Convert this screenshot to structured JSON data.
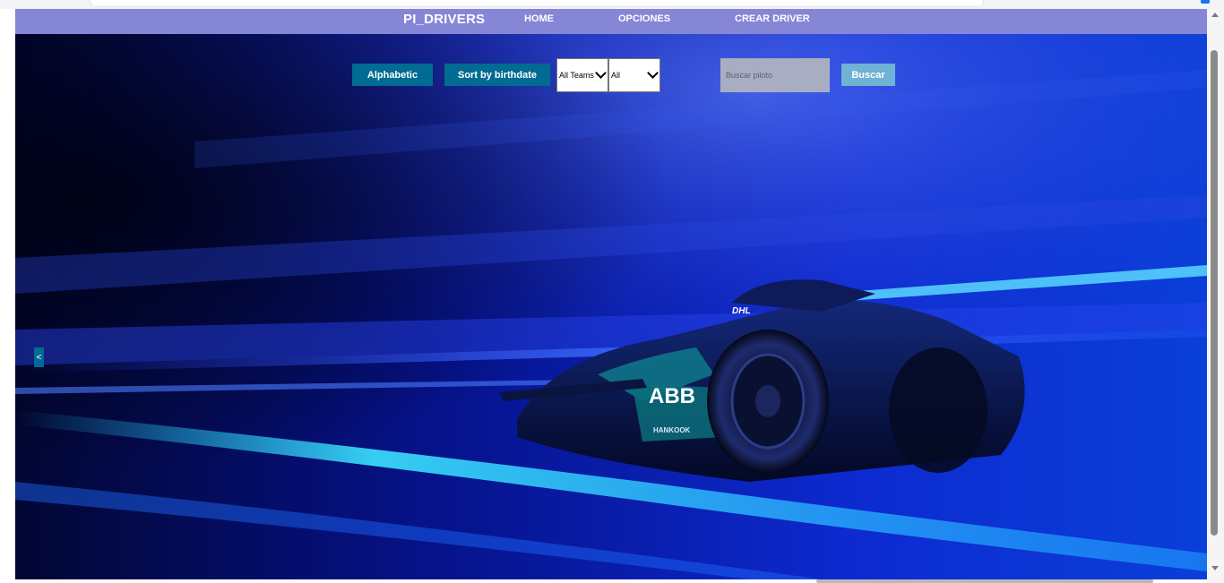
{
  "navbar": {
    "brand": "PI_DRIVERS",
    "links": [
      "HOME",
      "OPCIONES",
      "CREAR DRIVER"
    ],
    "background": "#8586d6"
  },
  "toolbar": {
    "sort_alpha_label": "Alphabetic",
    "sort_birthdate_label": "Sort by birthdate",
    "team_select_value": "All Teams",
    "origin_select_value": "All",
    "search_placeholder": "Buscar piloto",
    "search_button_label": "Buscar",
    "button_color": "#006b93",
    "search_button_color": "#6fb2d3"
  },
  "hero": {
    "car_livery_text": "ABB",
    "car_sponsor_text": "DHL",
    "car_tyre_text": "HANKOOK"
  },
  "pagination": {
    "prev_label": "<"
  }
}
